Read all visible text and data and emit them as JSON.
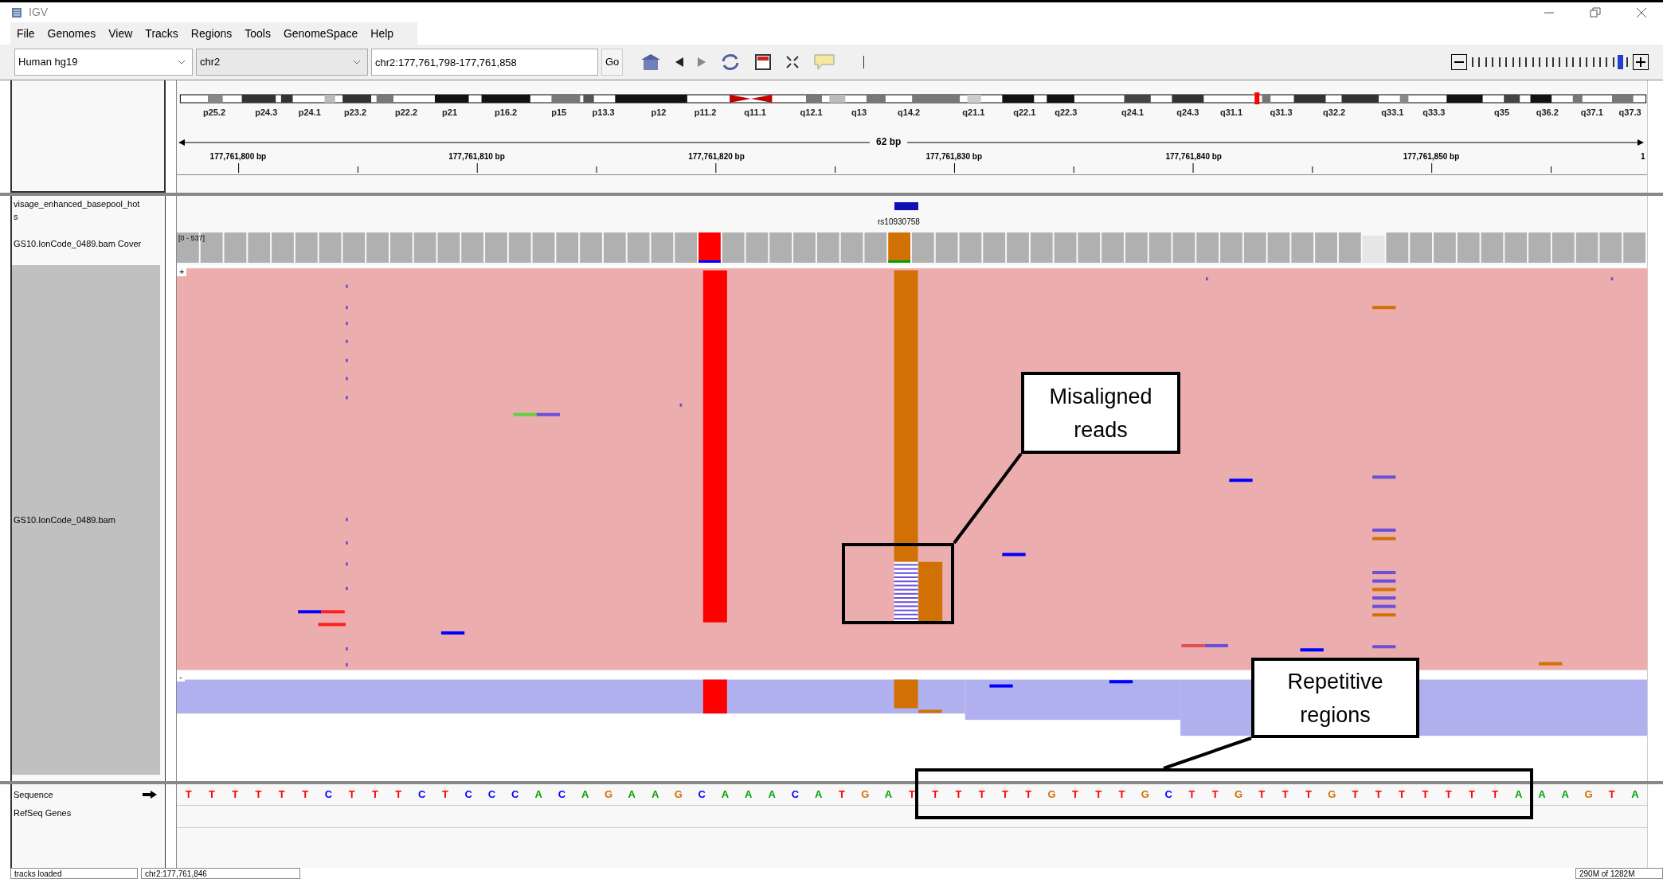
{
  "window": {
    "title": "IGV"
  },
  "menu": [
    "File",
    "Genomes",
    "View",
    "Tracks",
    "Regions",
    "Tools",
    "GenomeSpace",
    "Help"
  ],
  "toolbar": {
    "genome": "Human hg19",
    "chromosome": "chr2",
    "locus": "chr2:177,761,798-177,761,858",
    "go": "Go",
    "zoom": {
      "level": 0.97
    }
  },
  "ideogram": {
    "bands": [
      "p25.2",
      "p24.3",
      "p24.1",
      "p23.2",
      "p22.2",
      "p21",
      "p16.2",
      "p15",
      "p13.3",
      "p12",
      "p11.2",
      "q11.1",
      "q12.1",
      "q13",
      "q14.2",
      "q21.1",
      "q22.1",
      "q22.3",
      "q24.1",
      "q24.3",
      "q31.1",
      "q31.3",
      "q32.2",
      "q33.1",
      "q33.3",
      "q35",
      "q36.2",
      "q37.1",
      "q37.3"
    ]
  },
  "ruler": {
    "span": "62 bp",
    "ticks": [
      "177,761,800 bp",
      "177,761,810 bp",
      "177,761,820 bp",
      "177,761,830 bp",
      "177,761,840 bp",
      "177,761,850 bp",
      "1"
    ]
  },
  "feature_track": {
    "name_lines": [
      "visage_enhanced_basepool_hot",
      "s"
    ],
    "feature": "rs10930758"
  },
  "coverage_track": {
    "name": "GS10.IonCode_0489.bam Cover",
    "range": "[0 - 537]"
  },
  "alignment_track": {
    "name": "GS10.IonCode_0489.bam",
    "expand": "+",
    "collapse": "-"
  },
  "sequence_track": {
    "name": "Sequence",
    "bases": [
      {
        "base": "T",
        "color": "#ff0000"
      },
      {
        "base": "T",
        "color": "#ff0000"
      },
      {
        "base": "T",
        "color": "#ff0000"
      },
      {
        "base": "T",
        "color": "#ff0000"
      },
      {
        "base": "T",
        "color": "#ff0000"
      },
      {
        "base": "T",
        "color": "#ff0000"
      },
      {
        "base": "C",
        "color": "#0000ff"
      },
      {
        "base": "T",
        "color": "#ff0000"
      },
      {
        "base": "T",
        "color": "#ff0000"
      },
      {
        "base": "T",
        "color": "#ff0000"
      },
      {
        "base": "C",
        "color": "#0000ff"
      },
      {
        "base": "T",
        "color": "#ff0000"
      },
      {
        "base": "C",
        "color": "#0000ff"
      },
      {
        "base": "C",
        "color": "#0000ff"
      },
      {
        "base": "C",
        "color": "#0000ff"
      },
      {
        "base": "A",
        "color": "#00a000"
      },
      {
        "base": "C",
        "color": "#0000ff"
      },
      {
        "base": "A",
        "color": "#00a000"
      },
      {
        "base": "G",
        "color": "#d17105"
      },
      {
        "base": "A",
        "color": "#00a000"
      },
      {
        "base": "A",
        "color": "#00a000"
      },
      {
        "base": "G",
        "color": "#d17105"
      },
      {
        "base": "C",
        "color": "#0000ff"
      },
      {
        "base": "A",
        "color": "#00a000"
      },
      {
        "base": "A",
        "color": "#00a000"
      },
      {
        "base": "A",
        "color": "#00a000"
      },
      {
        "base": "C",
        "color": "#0000ff"
      },
      {
        "base": "A",
        "color": "#00a000"
      },
      {
        "base": "T",
        "color": "#ff0000"
      },
      {
        "base": "G",
        "color": "#d17105"
      },
      {
        "base": "A",
        "color": "#00a000"
      },
      {
        "base": "T",
        "color": "#ff0000"
      },
      {
        "base": "T",
        "color": "#ff0000"
      },
      {
        "base": "T",
        "color": "#ff0000"
      },
      {
        "base": "T",
        "color": "#ff0000"
      },
      {
        "base": "T",
        "color": "#ff0000"
      },
      {
        "base": "T",
        "color": "#ff0000"
      },
      {
        "base": "G",
        "color": "#d17105"
      },
      {
        "base": "T",
        "color": "#ff0000"
      },
      {
        "base": "T",
        "color": "#ff0000"
      },
      {
        "base": "T",
        "color": "#ff0000"
      },
      {
        "base": "G",
        "color": "#d17105"
      },
      {
        "base": "C",
        "color": "#0000ff"
      },
      {
        "base": "T",
        "color": "#ff0000"
      },
      {
        "base": "T",
        "color": "#ff0000"
      },
      {
        "base": "G",
        "color": "#d17105"
      },
      {
        "base": "T",
        "color": "#ff0000"
      },
      {
        "base": "T",
        "color": "#ff0000"
      },
      {
        "base": "T",
        "color": "#ff0000"
      },
      {
        "base": "G",
        "color": "#d17105"
      },
      {
        "base": "T",
        "color": "#ff0000"
      },
      {
        "base": "T",
        "color": "#ff0000"
      },
      {
        "base": "T",
        "color": "#ff0000"
      },
      {
        "base": "T",
        "color": "#ff0000"
      },
      {
        "base": "T",
        "color": "#ff0000"
      },
      {
        "base": "T",
        "color": "#ff0000"
      },
      {
        "base": "T",
        "color": "#ff0000"
      },
      {
        "base": "A",
        "color": "#00a000"
      },
      {
        "base": "A",
        "color": "#00a000"
      },
      {
        "base": "A",
        "color": "#00a000"
      },
      {
        "base": "G",
        "color": "#d17105"
      },
      {
        "base": "T",
        "color": "#ff0000"
      },
      {
        "base": "A",
        "color": "#00a000"
      }
    ]
  },
  "refseq_track": {
    "name": "RefSeq Genes"
  },
  "callouts": [
    {
      "text": "Misaligned reads"
    },
    {
      "text": "Repetitive regions"
    }
  ],
  "status_bar": [
    "tracks loaded",
    "chr2:177,761,846",
    "290M of 1282M"
  ]
}
